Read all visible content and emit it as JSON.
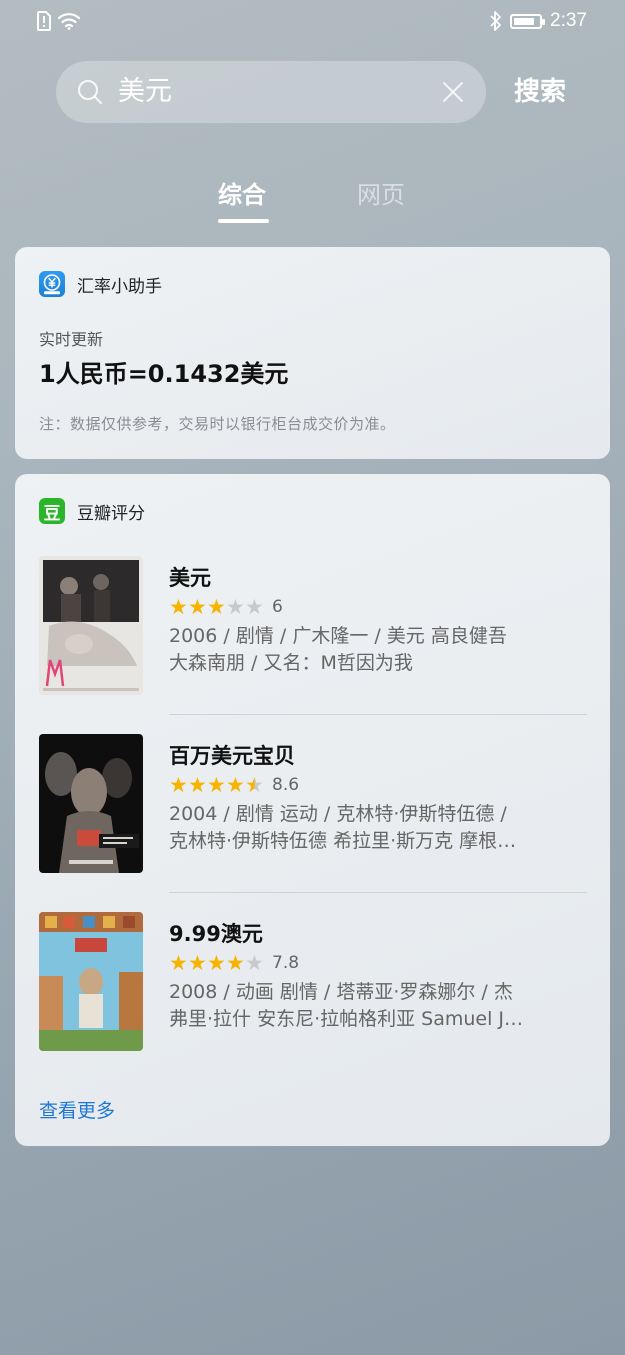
{
  "status_bar": {
    "time": "2:37",
    "battery_level": 0.85
  },
  "search": {
    "query": "美元",
    "button_label": "搜索"
  },
  "tabs": [
    {
      "label": "综合",
      "active": true
    },
    {
      "label": "网页",
      "active": false
    }
  ],
  "exchange_card": {
    "title": "汇率小助手",
    "icon": "yuan-exchange-icon",
    "label": "实时更新",
    "rate": "1人民币=0.1432美元",
    "note": "注：数据仅供参考，交易时以银行柜台成交价为准。"
  },
  "douban_card": {
    "title": "豆瓣评分",
    "icon_glyph": "豆",
    "more_link": "查看更多",
    "movies": [
      {
        "title": "美元",
        "stars": 3,
        "score": "6",
        "desc_line1": "2006 / 剧情 / 广木隆一 / 美元 高良健吾",
        "desc_line2": "大森南朋 / 又名：M哲因为我"
      },
      {
        "title": "百万美元宝贝",
        "stars": 4.5,
        "score": "8.6",
        "desc_line1": "2004 / 剧情 运动 / 克林特·伊斯特伍德 /",
        "desc_line2": "克林特·伊斯特伍德 希拉里·斯万克 摩根…"
      },
      {
        "title": "9.99澳元",
        "stars": 4,
        "score": "7.8",
        "desc_line1": "2008 / 动画 剧情 / 塔蒂亚·罗森娜尔 / 杰",
        "desc_line2": "弗里·拉什 安东尼·拉帕格利亚 Samuel J…"
      }
    ]
  },
  "colors": {
    "accent_link": "#1f78d6",
    "star": "#f6b400",
    "douban_green": "#2ab52a"
  }
}
